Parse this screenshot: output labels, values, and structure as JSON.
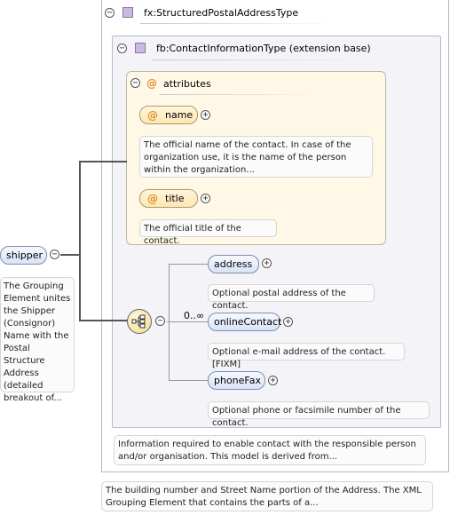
{
  "outer_type": {
    "label": "fx:StructuredPostalAddressType",
    "toggle": "−",
    "icon": "complex-type-icon"
  },
  "extension": {
    "label": "fb:ContactInformationType (extension base)",
    "toggle": "−",
    "icon": "complex-type-icon"
  },
  "attributes": {
    "label": "attributes",
    "toggle": "−",
    "icon_glyph": "@",
    "items": [
      {
        "name": "name",
        "icon_glyph": "@",
        "expand": "+",
        "note": "The official name of the contact. In case of the organization use, it is the name of the person within the organization..."
      },
      {
        "name": "title",
        "icon_glyph": "@",
        "expand": "+",
        "note": "The official title of the contact."
      }
    ]
  },
  "root_element": {
    "name": "shipper",
    "toggle": "−",
    "note": "The Grouping Element unites the Shipper (Consignor) Name with the Postal Structure Address (detailed breakout of..."
  },
  "sequence": {
    "cardinality": "0..∞",
    "toggle": "−",
    "icon": "sequence-compositor-icon"
  },
  "elements": [
    {
      "name": "address",
      "expand": "+",
      "note": "Optional postal address of the contact."
    },
    {
      "name": "onlineContact",
      "expand": "+",
      "note": "Optional e-mail address of the contact.[FIXM]"
    },
    {
      "name": "phoneFax",
      "expand": "+",
      "note": "Optional phone or facsimile number of the contact."
    }
  ],
  "extension_note": "Information required to enable contact with the responsible person and/or organisation. This model is derived from...",
  "outer_note": "The building number and Street Name portion of the Address. The XML Grouping Element that contains the parts of a...",
  "colors": {
    "attribute_fill": "#fde6b1",
    "element_fill": "#d9e3f6",
    "attribute_group_fill": "#fff8e6",
    "extension_fill": "#f3f3f8",
    "connector": "#555555"
  }
}
